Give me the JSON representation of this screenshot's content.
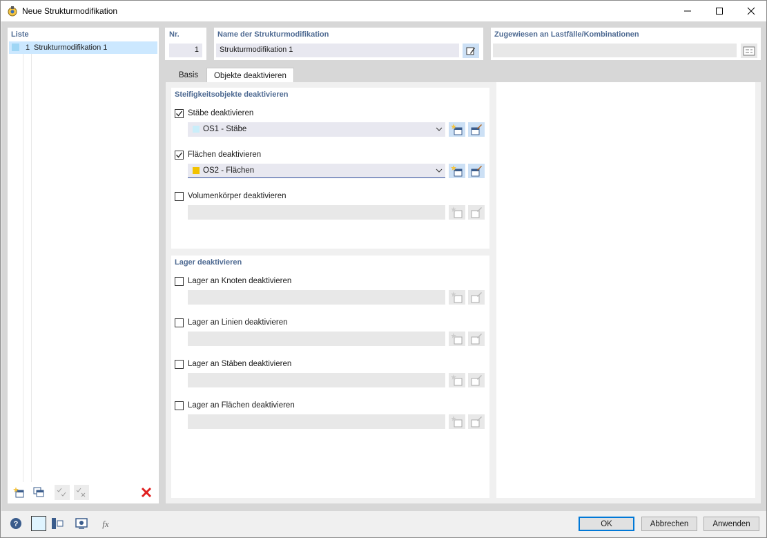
{
  "window": {
    "title": "Neue Strukturmodifikation"
  },
  "list": {
    "header": "Liste",
    "items": [
      {
        "num": "1",
        "name": "Strukturmodifikation 1",
        "color": "#9fd6f5"
      }
    ]
  },
  "nr": {
    "label": "Nr.",
    "value": "1"
  },
  "name": {
    "label": "Name der Strukturmodifikation",
    "value": "Strukturmodifikation 1"
  },
  "assigned": {
    "label": "Zugewiesen an Lastfälle/Kombinationen",
    "value": ""
  },
  "tabs": [
    {
      "label": "Basis",
      "active": false
    },
    {
      "label": "Objekte deaktivieren",
      "active": true
    }
  ],
  "stiffness": {
    "title": "Steifigkeitsobjekte deaktivieren",
    "items": [
      {
        "label": "Stäbe deaktivieren",
        "checked": true,
        "value": "OS1 - Stäbe",
        "color": "#c9eefa"
      },
      {
        "label": "Flächen deaktivieren",
        "checked": true,
        "value": "OS2 - Flächen",
        "color": "#f2c200"
      },
      {
        "label": "Volumenkörper deaktivieren",
        "checked": false,
        "value": "",
        "color": ""
      }
    ]
  },
  "supports": {
    "title": "Lager deaktivieren",
    "items": [
      {
        "label": "Lager an Knoten deaktivieren",
        "checked": false
      },
      {
        "label": "Lager an Linien deaktivieren",
        "checked": false
      },
      {
        "label": "Lager an Stäben deaktivieren",
        "checked": false
      },
      {
        "label": "Lager an Flächen deaktivieren",
        "checked": false
      }
    ]
  },
  "buttons": {
    "ok": "OK",
    "cancel": "Abbrechen",
    "apply": "Anwenden"
  },
  "colors": {
    "accent": "#0078d7",
    "section_label": "#4e6a92",
    "selection": "#cce8ff"
  }
}
